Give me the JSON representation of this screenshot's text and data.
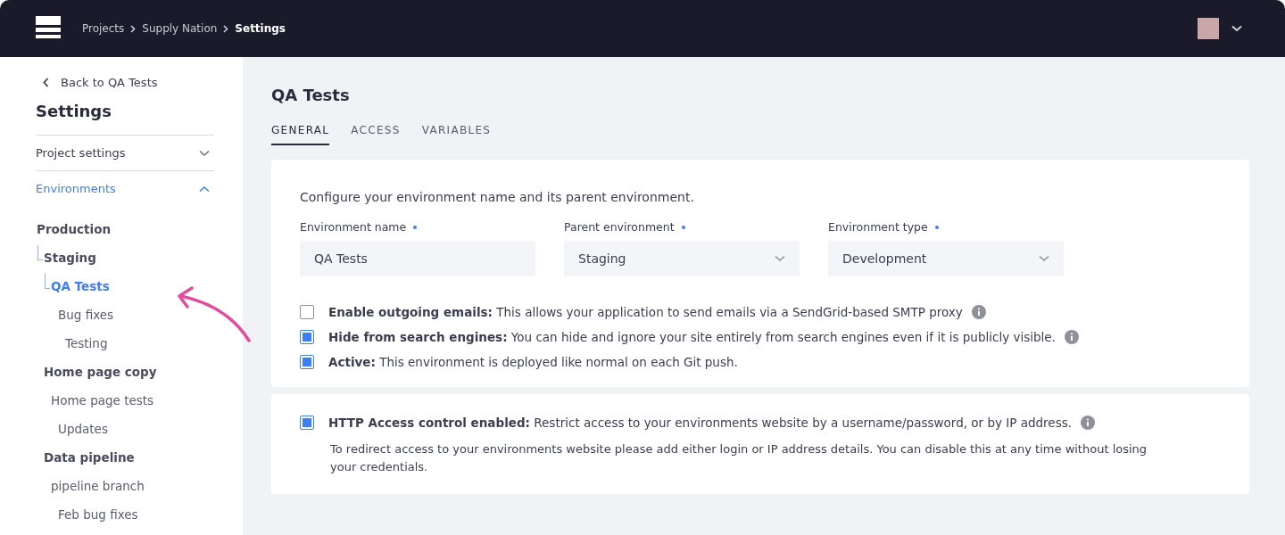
{
  "header": {
    "breadcrumbs": [
      {
        "label": "Projects",
        "selected": false
      },
      {
        "label": "Supply Nation",
        "selected": false
      },
      {
        "label": "Settings",
        "selected": true
      }
    ]
  },
  "sidebar": {
    "back_link": "Back to QA Tests",
    "title": "Settings",
    "sections": [
      {
        "label": "Project settings",
        "expanded": false
      },
      {
        "label": "Environments",
        "expanded": true
      }
    ],
    "tree": [
      {
        "label": "Production",
        "selected": false,
        "children": [
          {
            "label": "Staging",
            "selected": false,
            "children": [
              {
                "label": "QA Tests",
                "selected": true,
                "children": [
                  {
                    "label": "Bug fixes",
                    "selected": false,
                    "children": [
                      {
                        "label": "Testing",
                        "selected": false
                      }
                    ]
                  }
                ]
              }
            ]
          },
          {
            "label": "Home page copy",
            "selected": false,
            "children": [
              {
                "label": "Home page tests",
                "selected": false,
                "children": [
                  {
                    "label": "Updates",
                    "selected": false
                  }
                ]
              }
            ]
          },
          {
            "label": "Data pipeline",
            "selected": false,
            "children": [
              {
                "label": "pipeline branch",
                "selected": false,
                "children": [
                  {
                    "label": "Feb bug fixes",
                    "selected": false
                  }
                ]
              }
            ]
          }
        ]
      }
    ]
  },
  "page": {
    "title": "QA Tests",
    "tabs": [
      {
        "label": "GENERAL",
        "selected": true
      },
      {
        "label": "ACCESS",
        "selected": false
      },
      {
        "label": "VARIABLES",
        "selected": false
      }
    ],
    "general_card": {
      "intro": "Configure your environment name and its parent environment.",
      "fields": [
        {
          "kind": "text",
          "label": "Environment name",
          "required": true,
          "value": "QA Tests"
        },
        {
          "kind": "select",
          "label": "Parent environment",
          "required": true,
          "value": "Staging"
        },
        {
          "kind": "select",
          "label": "Environment type",
          "required": true,
          "value": "Development"
        }
      ],
      "options": [
        {
          "text": "**Enable outgoing emails:** This allows your application to send emails via a SendGrid-based SMTP proxy",
          "checked": false,
          "info": true
        },
        {
          "text": "**Hide from search engines:** You can hide and ignore your site entirely from search engines even if it is publicly visible.",
          "checked": true,
          "info": true
        },
        {
          "text": "**Active:** This environment is deployed like normal on each Git push.",
          "checked": true,
          "info": false
        }
      ]
    },
    "access_card": {
      "option": {
        "text": "**HTTP Access control enabled:** Restrict access to your environments website by a username/password, or by IP address.",
        "checked": true,
        "info": true
      },
      "note": "To redirect access to your environments website please add either login or IP address details. You can disable this at any time without losing your credentials."
    }
  }
}
